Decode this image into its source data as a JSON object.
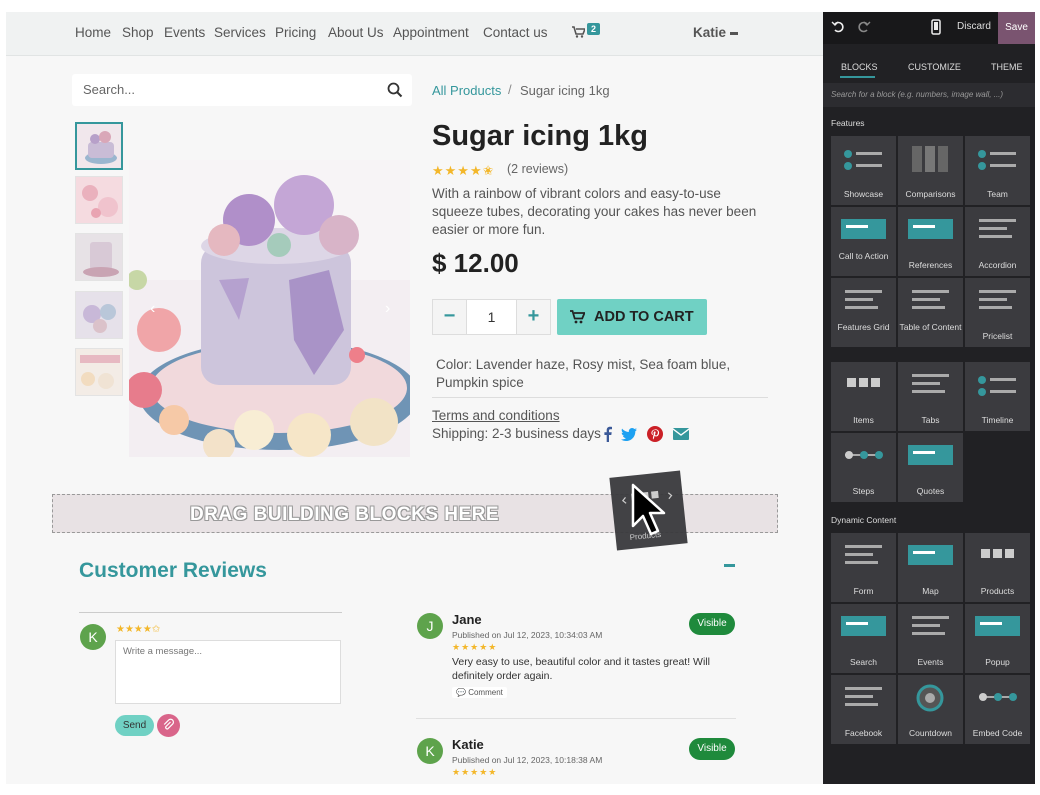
{
  "nav": {
    "links": [
      "Home",
      "Shop",
      "Events",
      "Services",
      "Pricing",
      "About Us",
      "Appointment",
      "Contact us"
    ],
    "cart_count": "2",
    "user": "Katie"
  },
  "search": {
    "placeholder": "Search..."
  },
  "breadcrumb": {
    "link": "All Products",
    "separator": "/",
    "current": "Sugar icing 1kg"
  },
  "product": {
    "title": "Sugar icing 1kg",
    "stars": "★★★★✬",
    "review_count": "(2 reviews)",
    "description": "With a rainbow of vibrant colors and easy-to-use squeeze tubes, decorating your cakes has never been easier or more fun.",
    "price": "$ 12.00",
    "quantity": "1",
    "add_to_cart": "ADD TO CART",
    "colors": "Color: Lavender haze, Rosy mist, Sea foam blue, Pumpkin spice",
    "terms": "Terms and conditions",
    "shipping": "Shipping: 2-3 business days"
  },
  "drop_zone": {
    "text": "DRAG BUILDING BLOCKS HERE",
    "ghost_label": "Products"
  },
  "reviews": {
    "title": "Customer Reviews",
    "form": {
      "avatar": "K",
      "stars": "★★★★✩",
      "placeholder": "Write a message...",
      "send": "Send"
    },
    "items": [
      {
        "initial": "J",
        "name": "Jane",
        "date": "Published on Jul 12, 2023, 10:34:03 AM",
        "stars": "★★★★★",
        "text": "Very easy to use, beautiful color and it tastes great! Will definitely order again.",
        "comment": "Comment",
        "badge": "Visible"
      },
      {
        "initial": "K",
        "name": "Katie",
        "date": "Published on Jul 12, 2023, 10:18:38 AM",
        "stars": "★★★★★",
        "badge": "Visible"
      }
    ]
  },
  "panel": {
    "discard": "Discard",
    "save": "Save",
    "tabs": [
      "BLOCKS",
      "CUSTOMIZE",
      "THEME"
    ],
    "search_placeholder": "Search for a block (e.g. numbers, image wall, ...)",
    "features_label": "Features",
    "features": [
      "Showcase",
      "Comparisons",
      "Team",
      "Call to Action",
      "References",
      "Accordion",
      "Features Grid",
      "Table of Content",
      "Pricelist",
      "Items",
      "Tabs",
      "Timeline",
      "Steps",
      "Quotes"
    ],
    "dynamic_label": "Dynamic Content",
    "dynamic": [
      "Form",
      "Map",
      "Products",
      "Search",
      "Events",
      "Popup",
      "Facebook",
      "Countdown",
      "Embed Code"
    ]
  },
  "colors": {
    "accent": "#35979c",
    "cart_button": "#70d1c4",
    "visible_badge": "#1f8a3c",
    "save_button": "#7a5470",
    "panel_bg": "#212124"
  }
}
